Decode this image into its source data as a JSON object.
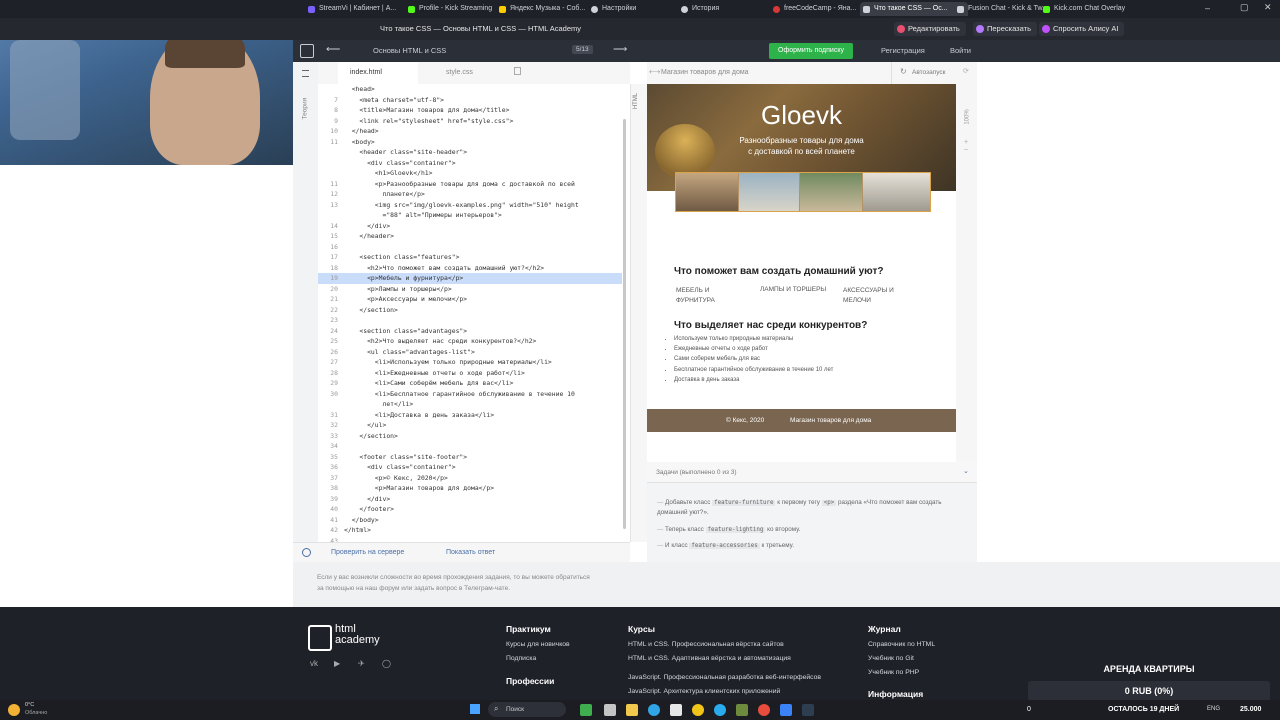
{
  "browser_tabs": [
    {
      "label": "StreamVi | Кабинет | А...",
      "color": "#7b61ff"
    },
    {
      "label": "Profile - Kick Streaming",
      "color": "#53fc18"
    },
    {
      "label": "Яндекс Музыка - Соб...",
      "color": "#ffcc00"
    },
    {
      "label": "Настройки",
      "color": "#cfd2d8"
    },
    {
      "label": "История",
      "color": "#cfd2d8"
    },
    {
      "label": "freeCodeCamp - Яна...",
      "color": "#d9383a"
    },
    {
      "label": "Что такое CSS — Ос...",
      "color": "#cfd2d8"
    },
    {
      "label": "Fusion Chat - Kick & Tw...",
      "color": "#cfd2d8"
    },
    {
      "label": "Kick.com Chat Overlay",
      "color": "#53fc18"
    }
  ],
  "window_title": "Что такое CSS — Основы HTML и CSS — HTML Academy",
  "title_buttons": [
    "Редактировать",
    "Пересказать",
    "Спросить Алису AI"
  ],
  "academy": {
    "back_arrow": "⟵",
    "course": "Основы HTML и CSS",
    "progress": "5/13",
    "forward_arrow": "⟶",
    "subscribe": "Оформить подписку",
    "register": "Регистрация",
    "login": "Войти",
    "theory": "Теория"
  },
  "editor": {
    "tabs": [
      "index.html",
      "style.css"
    ],
    "vertical_label": "HTML",
    "lines": [
      {
        "n": "",
        "code": "  <head>"
      },
      {
        "n": "7",
        "code": "    <meta charset=\"utf-8\">"
      },
      {
        "n": "8",
        "code": "    <title>Магазин товаров для дома</title>"
      },
      {
        "n": "9",
        "code": "    <link rel=\"stylesheet\" href=\"style.css\">"
      },
      {
        "n": "10",
        "code": "  </head>"
      },
      {
        "n": "11",
        "code": "  <body>"
      },
      {
        "n": "",
        "code": "    <header class=\"site-header\">"
      },
      {
        "n": "",
        "code": "      <div class=\"container\">"
      },
      {
        "n": "",
        "code": "        <h1>Gloevk</h1>"
      },
      {
        "n": "11",
        "code": "        <p>Разнообразные товары для дома с доставкой по всей"
      },
      {
        "n": "12",
        "code": "          планете</p>"
      },
      {
        "n": "13",
        "code": "        <img src=\"img/gloevk-examples.png\" width=\"510\" height"
      },
      {
        "n": "",
        "code": "          =\"88\" alt=\"Примеры интерьеров\">"
      },
      {
        "n": "14",
        "code": "      </div>"
      },
      {
        "n": "15",
        "code": "    </header>"
      },
      {
        "n": "16",
        "code": ""
      },
      {
        "n": "17",
        "code": "    <section class=\"features\">"
      },
      {
        "n": "18",
        "code": "      <h2>Что поможет вам создать домашний уют?</h2>"
      },
      {
        "n": "19",
        "code": "      <p>Мебель и фурнитура</p>"
      },
      {
        "n": "20",
        "code": "      <p>Лампы и торшеры</p>"
      },
      {
        "n": "21",
        "code": "      <p>Аксессуары и мелочи</p>"
      },
      {
        "n": "22",
        "code": "    </section>"
      },
      {
        "n": "23",
        "code": ""
      },
      {
        "n": "24",
        "code": "    <section class=\"advantages\">"
      },
      {
        "n": "25",
        "code": "      <h2>Что выделяет нас среди конкурентов?</h2>"
      },
      {
        "n": "26",
        "code": "      <ul class=\"advantages-list\">"
      },
      {
        "n": "27",
        "code": "        <li>Используем только природные материалы</li>"
      },
      {
        "n": "28",
        "code": "        <li>Ежедневные отчеты о ходе работ</li>"
      },
      {
        "n": "29",
        "code": "        <li>Сами соберём мебель для вас</li>"
      },
      {
        "n": "30",
        "code": "        <li>Бесплатное гарантийное обслуживание в течение 10"
      },
      {
        "n": "",
        "code": "          лет</li>"
      },
      {
        "n": "31",
        "code": "        <li>Доставка в день заказа</li>"
      },
      {
        "n": "32",
        "code": "      </ul>"
      },
      {
        "n": "33",
        "code": "    </section>"
      },
      {
        "n": "34",
        "code": ""
      },
      {
        "n": "35",
        "code": "    <footer class=\"site-footer\">"
      },
      {
        "n": "36",
        "code": "      <div class=\"container\">"
      },
      {
        "n": "37",
        "code": "        <p>© Кекс, 2020</p>"
      },
      {
        "n": "38",
        "code": "        <p>Магазин товаров для дома</p>"
      },
      {
        "n": "39",
        "code": "      </div>"
      },
      {
        "n": "40",
        "code": "    </footer>"
      },
      {
        "n": "41",
        "code": "  </body>"
      },
      {
        "n": "42",
        "code": "</html>"
      },
      {
        "n": "43",
        "code": ""
      }
    ],
    "highlight_index": 18,
    "check": "Проверить на сервере",
    "show_answer": "Показать ответ"
  },
  "preview": {
    "title": "Магазин товаров для дома",
    "autorun": "Автозапуск",
    "zoom": "100%",
    "brand": "Gloevk",
    "tagline_1": "Разнообразные товары для дома",
    "tagline_2": "с доставкой по всей планете",
    "features_title": "Что поможет вам создать домашний уют?",
    "features": [
      "МЕБЕЛЬ И\nФУРНИТУРА",
      "ЛАМПЫ И ТОРШЕРЫ",
      "АКСЕССУАРЫ И\nМЕЛОЧИ"
    ],
    "advantages_title": "Что выделяет нас среди конкурентов?",
    "advantages": [
      "Используем только природные материалы",
      "Ежедневные отчеты о ходе работ",
      "Сами соберем мебель для вас",
      "Бесплатное гарантийное обслуживание в течение 10 лет",
      "Доставка в день заказа"
    ],
    "footer_copy": "© Кекс, 2020",
    "footer_name": "Магазин товаров для дома",
    "footer_color": "#7a6650"
  },
  "tasks": {
    "header": "Задачи (выполнено 0 из 3)",
    "t1_a": "Добавьте класс",
    "t1_code": "feature-furniture",
    "t1_b": "к первому тегу",
    "t1_code2": "<p>",
    "t1_c": "раздела «Что поможет вам создать домашний уют?».",
    "t2_a": "Теперь класс",
    "t2_code": "feature-lighting",
    "t2_b": "ко второму.",
    "t3_a": "И класс",
    "t3_code": "feature-accessories",
    "t3_b": "к третьему."
  },
  "help_text_1": "Если у вас возникли сложности во время прохождения задания, то вы можете обратиться",
  "help_text_2": "за помощью на наш форум или задать вопрос в Телеграм-чате.",
  "footer": {
    "logo": "html\nacademy",
    "cols": [
      {
        "title": "Практикум",
        "items": [
          "Курсы для новичков",
          "Подписка"
        ]
      },
      {
        "title": "Курсы",
        "items": [
          "HTML и CSS. Профессиональная вёрстка сайтов",
          "HTML и CSS. Адаптивная вёрстка и автоматизация"
        ]
      },
      {
        "title": "Журнал",
        "items": [
          "Справочник по HTML",
          "Учебник по Git",
          "Учебник по PHP"
        ]
      }
    ],
    "professions": "Профессии",
    "js_items": [
      "JavaScript. Профессиональная разработка веб-интерфейсов",
      "JavaScript. Архитектура клиентских приложений"
    ],
    "info": "Информация"
  },
  "overlay": {
    "rent": "АРЕНДА КВАРТИРЫ",
    "amount": "0 RUB (0%)",
    "left": "ОСТАЛОСЬ 19 ДНЕЙ",
    "num": "25.000",
    "zero": "0"
  },
  "taskbar": {
    "weather": "0°C",
    "weather2": "Облачно",
    "search": "Поиск",
    "lang": "ENG"
  }
}
